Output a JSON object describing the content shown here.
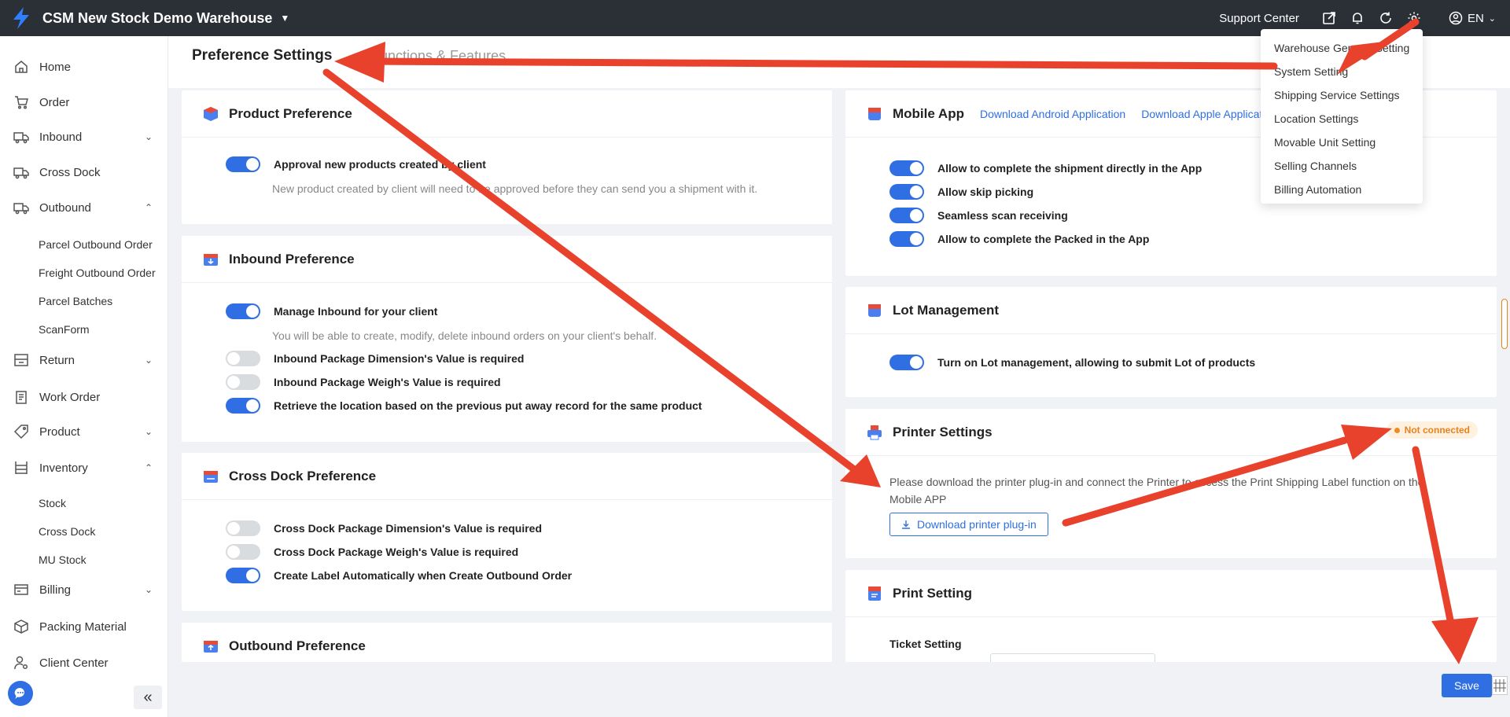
{
  "header": {
    "warehouse_name": "CSM New Stock Demo Warehouse",
    "support_label": "Support Center",
    "language": "EN"
  },
  "sidebar": {
    "items": [
      {
        "label": "Home",
        "icon": "home-icon"
      },
      {
        "label": "Order",
        "icon": "cart-icon"
      },
      {
        "label": "Inbound",
        "icon": "truck-icon"
      },
      {
        "label": "Cross Dock",
        "icon": "truck-icon"
      },
      {
        "label": "Outbound",
        "icon": "truck-icon"
      },
      {
        "label": "Return",
        "icon": "return-icon"
      },
      {
        "label": "Work Order",
        "icon": "clipboard-icon"
      },
      {
        "label": "Product",
        "icon": "tag-icon"
      },
      {
        "label": "Inventory",
        "icon": "shelf-icon"
      },
      {
        "label": "Billing",
        "icon": "card-icon"
      },
      {
        "label": "Packing Material",
        "icon": "box-icon"
      },
      {
        "label": "Client Center",
        "icon": "user-gear-icon"
      }
    ],
    "outbound_sub": [
      "Parcel Outbound Order",
      "Freight Outbound Order",
      "Parcel Batches",
      "ScanForm"
    ],
    "inventory_sub": [
      "Stock",
      "Cross Dock",
      "MU Stock"
    ]
  },
  "tabs": {
    "active": "Preference Settings",
    "other": "Functions & Features"
  },
  "product_pref": {
    "title": "Product Preference",
    "toggle_label": "Approval new products created by client",
    "hint": "New product created by client will need to be approved before they can send you a shipment with it."
  },
  "inbound_pref": {
    "title": "Inbound Preference",
    "manage_label": "Manage Inbound for your client",
    "manage_hint": "You will be able to create, modify, delete inbound orders on your client's behalf.",
    "dimension_label": "Inbound Package Dimension's Value is required",
    "weigh_label": "Inbound Package Weigh's Value is required",
    "retrieve_label": "Retrieve the location based on the previous put away record for the same product"
  },
  "crossdock_pref": {
    "title": "Cross Dock Preference",
    "dimension_label": "Cross Dock Package Dimension's Value is required",
    "weigh_label": "Cross Dock Package Weigh's Value is required",
    "label_label": "Create Label Automatically when Create Outbound Order"
  },
  "outbound_pref": {
    "title": "Outbound Preference"
  },
  "mobile_app": {
    "title": "Mobile App",
    "android_link": "Download Android Application",
    "apple_link": "Download Apple Applicati",
    "toggles": [
      "Allow to complete the shipment directly in the App",
      "Allow skip picking",
      "Seamless scan receiving",
      "Allow to complete the Packed in the App"
    ]
  },
  "lot": {
    "title": "Lot Management",
    "toggle_label": "Turn on Lot management, allowing to submit Lot of products"
  },
  "printer": {
    "title": "Printer Settings",
    "status": "Not connected",
    "description": "Please download the printer plug-in and connect the Printer to access the Print Shipping Label function on the Mobile APP",
    "download_label": "Download printer plug-in"
  },
  "print_setting": {
    "title": "Print Setting",
    "ticket_label": "Ticket Setting"
  },
  "dropdown": {
    "items": [
      "Warehouse General Setting",
      "System Setting",
      "Shipping Service Settings",
      "Location Settings",
      "Movable Unit Setting",
      "Selling Channels",
      "Billing Automation"
    ]
  },
  "actions": {
    "save_label": "Save"
  },
  "colors": {
    "topbar": "#2b2f36",
    "accent": "#2f6fe3",
    "annotation_arrow": "#e8412c",
    "warning": "#e8821c"
  }
}
